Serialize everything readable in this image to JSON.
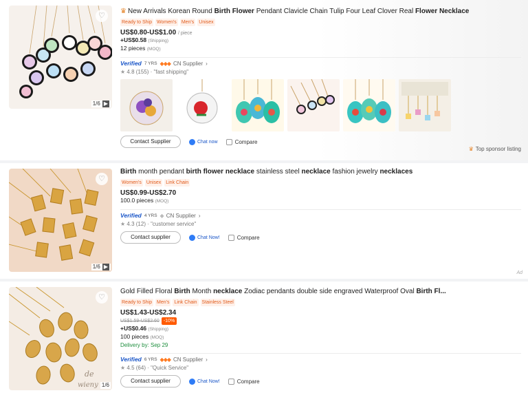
{
  "colors": {
    "accent": "#ff6a00",
    "verified": "#1a56c8",
    "tag_text": "#e05a1a",
    "tag_bg": "#fff1ea"
  },
  "listings": [
    {
      "title_parts": [
        {
          "t": "New Arrivals Korean Round ",
          "b": false
        },
        {
          "t": "Birth Flower",
          "b": true
        },
        {
          "t": " Pendant Clavicle Chain Tulip Four Leaf Clover Real ",
          "b": false
        },
        {
          "t": "Flower Necklace",
          "b": true
        }
      ],
      "tags": [
        "Ready to Ship",
        "Women's",
        "Men's",
        "Unisex"
      ],
      "price": "US$0.80-US$1.00",
      "price_unit": "/ piece",
      "shipping": "+US$0.58",
      "shipping_label": "(Shipping)",
      "moq": "12 pieces",
      "moq_label": "(MOQ)",
      "verified": "Verified",
      "years": "7 YRS",
      "country": "CN Supplier",
      "rating": "4.8 (155)",
      "review": "\"fast shipping\"",
      "image_count": "1/6",
      "contact_label": "Contact Supplier",
      "chat_label": "Chat now",
      "compare_label": "Compare",
      "sponsor_label": "Top sponsor listing"
    },
    {
      "title_parts": [
        {
          "t": "Birth",
          "b": true
        },
        {
          "t": " month pendant ",
          "b": false
        },
        {
          "t": "birth flower necklace",
          "b": true
        },
        {
          "t": " stainless steel ",
          "b": false
        },
        {
          "t": "necklace",
          "b": true
        },
        {
          "t": " fashion jewelry ",
          "b": false
        },
        {
          "t": "necklaces",
          "b": true
        }
      ],
      "tags": [
        "Women's",
        "Unisex",
        "Link Chain"
      ],
      "price": "US$0.99-US$2.70",
      "moq": "100.0 pieces",
      "moq_label": "(MOQ)",
      "verified": "Verified",
      "years": "4 YRS",
      "country": "CN Supplier",
      "rating": "4.3 (12)",
      "review": "\"customer service\"",
      "image_count": "1/6",
      "contact_label": "Contact supplier",
      "chat_label": "Chat Now!",
      "compare_label": "Compare",
      "ad_label": "Ad"
    },
    {
      "title_parts": [
        {
          "t": "Gold Filled Floral ",
          "b": false
        },
        {
          "t": "Birth",
          "b": true
        },
        {
          "t": " Month ",
          "b": false
        },
        {
          "t": "necklace",
          "b": true
        },
        {
          "t": " Zodiac pendants double side engraved Waterproof Oval ",
          "b": false
        },
        {
          "t": "Birth Fl...",
          "b": true
        }
      ],
      "tags": [
        "Ready to Ship",
        "Men's",
        "Link Chain",
        "Stainless Steel"
      ],
      "price": "US$1.43-US$2.34",
      "old_price": "US$1.59-US$2.60",
      "discount": "-10%",
      "shipping": "+US$0.46",
      "shipping_label": "(Shipping)",
      "moq": "100 pieces",
      "moq_label": "(MOQ)",
      "delivery": "Delivery by: Sep 29",
      "verified": "Verified",
      "years": "6 YRS",
      "country": "CN Supplier",
      "rating": "4.5 (64)",
      "review": "\"Quick Service\"",
      "image_count": "1/6",
      "contact_label": "Contact supplier",
      "chat_label": "Chat Now!",
      "compare_label": "Compare"
    }
  ]
}
